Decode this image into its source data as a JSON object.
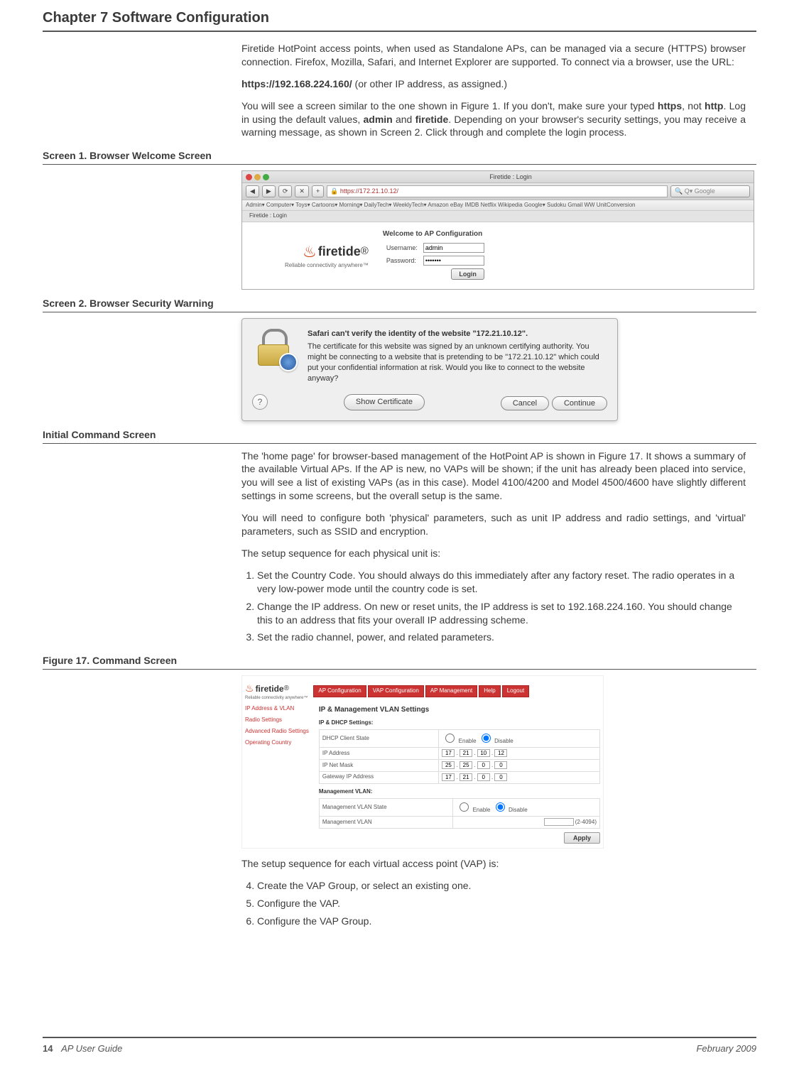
{
  "chapter": "Chapter 7    Software Configuration",
  "intro_p1": "Firetide HotPoint access points, when used as Standalone APs, can be managed via a secure (HTTPS) browser connection. Firefox, Mozilla, Safari, and Internet Explorer are supported. To connect via a browser, use the URL:",
  "url_line_bold": "https://192.168.224.160/",
  "url_line_rest": "  (or other IP address, as assigned.)",
  "intro_p2a": "You will see a screen similar to the one shown in Figure 1. If you don't, make sure your typed ",
  "intro_p2_b1": "https",
  "intro_p2_mid1": ", not ",
  "intro_p2_b2": "http",
  "intro_p2_mid2": ". Log in using the default values, ",
  "intro_p2_b3": "admin",
  "intro_p2_mid3": " and ",
  "intro_p2_b4": "firetide",
  "intro_p2_end": ". Depending on your browser's security settings, you may receive a warning message, as shown in Screen 2. Click through and complete the login process.",
  "screen1_label": "Screen 1. Browser Welcome Screen",
  "browser": {
    "title": "Firetide : Login",
    "url": "https://172.21.10.12/",
    "search_placeholder": "Google",
    "bookmarks": "Admin▾   Computer▾   Toys▾   Cartoons▾   Morning▾   DailyTech▾   WeeklyTech▾   Amazon   eBay   IMDB   Netflix   Wikipedia   Google▾   Sudoku   Gmail   WW   UnitConversion",
    "tab": "Firetide : Login",
    "welcome_heading": "Welcome to AP Configuration",
    "username_label": "Username:",
    "username_value": "admin",
    "password_label": "Password:",
    "password_value": "•••••••",
    "login_btn": "Login",
    "logo_text": "firetide",
    "logo_r": "®",
    "logo_tag": "Reliable connectivity anywhere™"
  },
  "screen2_label": "Screen 2. Browser Security Warning",
  "sec": {
    "title": "Safari can't verify the identity of the website \"172.21.10.12\".",
    "body": "The certificate for this website was signed by an unknown certifying authority. You might be connecting to a website that is pretending to be \"172.21.10.12\" which could put your confidential information at risk. Would you like to connect to the website anyway?",
    "help": "?",
    "show": "Show Certificate",
    "cancel": "Cancel",
    "cont": "Continue"
  },
  "init_label": "Initial Command Screen",
  "home_p1": "The 'home page' for browser-based management of the HotPoint AP is shown in Figure 17. It shows a summary of the available Virtual APs. If the AP is new, no VAPs will be shown; if the unit has already been placed into service, you will see a list of existing VAPs (as in this case). Model 4100/4200 and Model 4500/4600 have slightly different settings in some screens, but the overall setup is the same.",
  "home_p2": "You will need to configure both 'physical' parameters, such as unit IP address and radio settings, and 'virtual' parameters, such as SSID and encryption.",
  "home_p3": "The setup sequence for each physical unit is:",
  "steps_a": [
    "Set the Country Code. You should always do this immediately after any factory reset. The radio operates in a very low-power mode until the country code is set.",
    "Change the IP address. On new or reset units, the IP address is set to 192.168.224.160. You should change this to an address that fits your overall IP addressing scheme.",
    "Set the radio channel, power, and related parameters."
  ],
  "fig17_label": "Figure 17. Command Screen",
  "fig17": {
    "logo": "firetide",
    "logo_r": "®",
    "logo_tag": "Reliable connectivity anywhere™",
    "tabs": [
      "AP Configuration",
      "VAP Configuration",
      "AP Management",
      "Help",
      "Logout"
    ],
    "sidebar": [
      "IP Address & VLAN",
      "Radio Settings",
      "Advanced Radio Settings",
      "Operating Country"
    ],
    "sec_title": "IP & Management VLAN Settings",
    "sub1": "IP & DHCP Settings:",
    "rows1": [
      {
        "label": "DHCP Client State",
        "enable": "Enable",
        "disable": "Disable"
      },
      {
        "label": "IP Address",
        "ip": [
          "17",
          "21",
          "10",
          "12"
        ]
      },
      {
        "label": "IP Net Mask",
        "ip": [
          "25",
          "25",
          "0",
          "0"
        ]
      },
      {
        "label": "Gateway IP Address",
        "ip": [
          "17",
          "21",
          "0",
          "0"
        ]
      }
    ],
    "sub2": "Management VLAN:",
    "rows2": [
      {
        "label": "Management VLAN State",
        "enable": "Enable",
        "disable": "Disable"
      },
      {
        "label": "Management VLAN",
        "hint": "(2-4094)"
      }
    ],
    "apply": "Apply"
  },
  "vap_intro": "The setup sequence for each virtual access point (VAP) is:",
  "steps_b": [
    "Create the VAP Group, or select an existing one.",
    "Configure the VAP.",
    "Configure the VAP Group."
  ],
  "footer": {
    "page": "14",
    "title": "AP User Guide",
    "date": "February 2009"
  }
}
